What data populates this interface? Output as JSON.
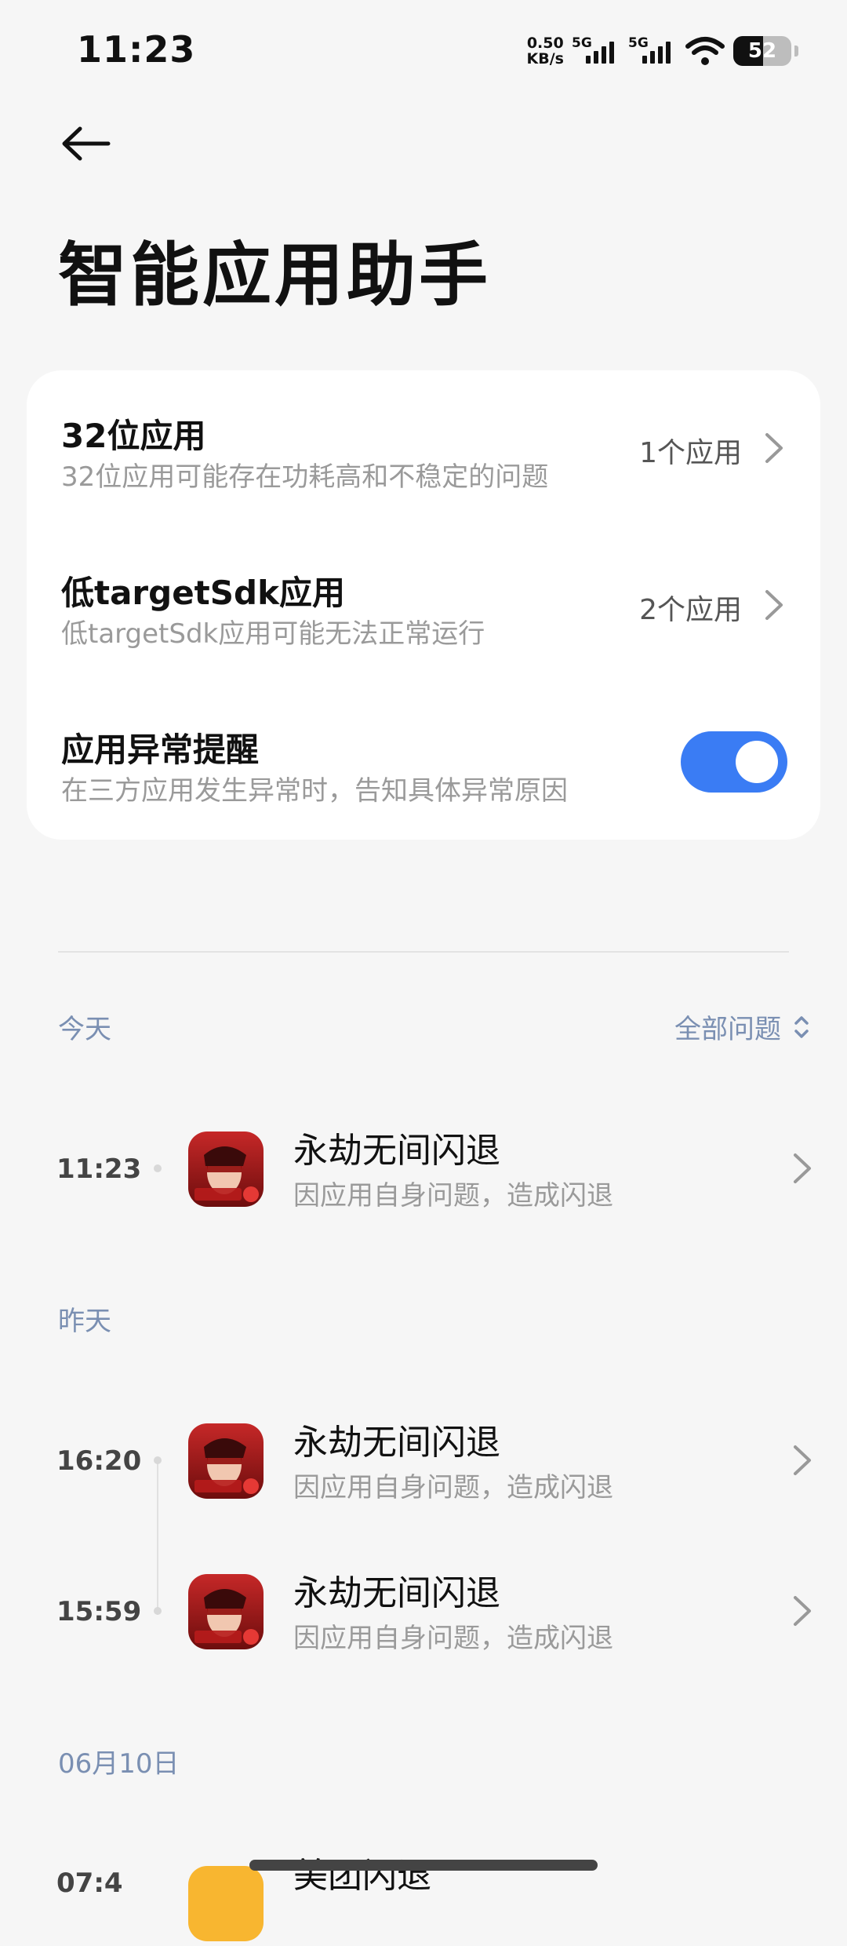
{
  "status_bar": {
    "time": "11:23",
    "net_speed_value": "0.50",
    "net_speed_unit": "KB/s",
    "sim1_label": "5G",
    "sim2_label": "5G",
    "battery": "52",
    "battery_level": 0.52
  },
  "header": {
    "title": "智能应用助手"
  },
  "settings": {
    "bit32": {
      "title": "32位应用",
      "subtitle": "32位应用可能存在功耗高和不稳定的问题",
      "value": "1个应用"
    },
    "low_sdk": {
      "title": "低targetSdk应用",
      "subtitle": "低targetSdk应用可能无法正常运行",
      "value": "2个应用"
    },
    "crash_alert": {
      "title": "应用异常提醒",
      "subtitle": "在三方应用发生异常时，告知具体异常原因",
      "enabled": true
    }
  },
  "filter_label": "全部问题",
  "sections": {
    "today": "今天",
    "yesterday": "昨天",
    "jun10": "06月10日"
  },
  "entries": [
    {
      "time": "11:23",
      "app": "永劫无间闪退",
      "reason": "因应用自身问题，造成闪退"
    },
    {
      "time": "16:20",
      "app": "永劫无间闪退",
      "reason": "因应用自身问题，造成闪退"
    },
    {
      "time": "15:59",
      "app": "永劫无间闪退",
      "reason": "因应用自身问题，造成闪退"
    },
    {
      "time": "07:4",
      "app": "美团闪退"
    }
  ],
  "colors": {
    "accent": "#3a7cf4",
    "section_label": "#7a8fb2",
    "background": "#f6f6f6"
  }
}
